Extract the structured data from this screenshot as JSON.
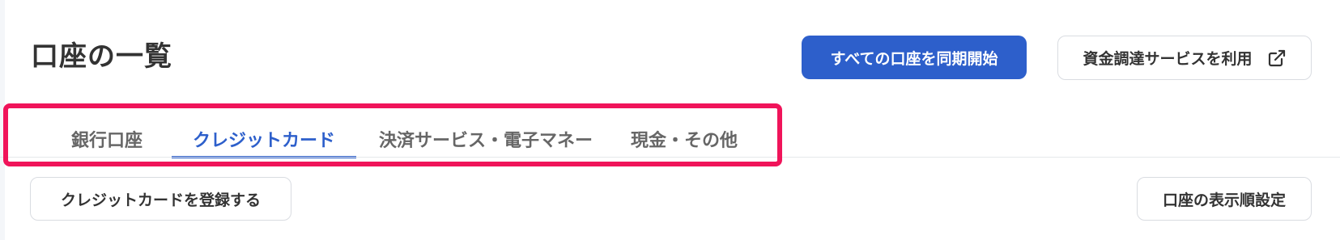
{
  "header": {
    "title": "口座の一覧",
    "sync_all_label": "すべての口座を同期開始",
    "fund_service_label": "資金調達サービスを利用",
    "fund_service_icon": "external-link-icon"
  },
  "tabs": [
    {
      "label": "銀行口座",
      "active": false
    },
    {
      "label": "クレジットカード",
      "active": true
    },
    {
      "label": "決済サービス・電子マネー",
      "active": false
    },
    {
      "label": "現金・その他",
      "active": false
    }
  ],
  "actions": {
    "register_card_label": "クレジットカードを登録する",
    "display_order_label": "口座の表示順設定"
  },
  "colors": {
    "primary": "#2d5fcb",
    "highlight": "#f0145a",
    "text": "#333333",
    "inactive_tab": "#666666"
  }
}
